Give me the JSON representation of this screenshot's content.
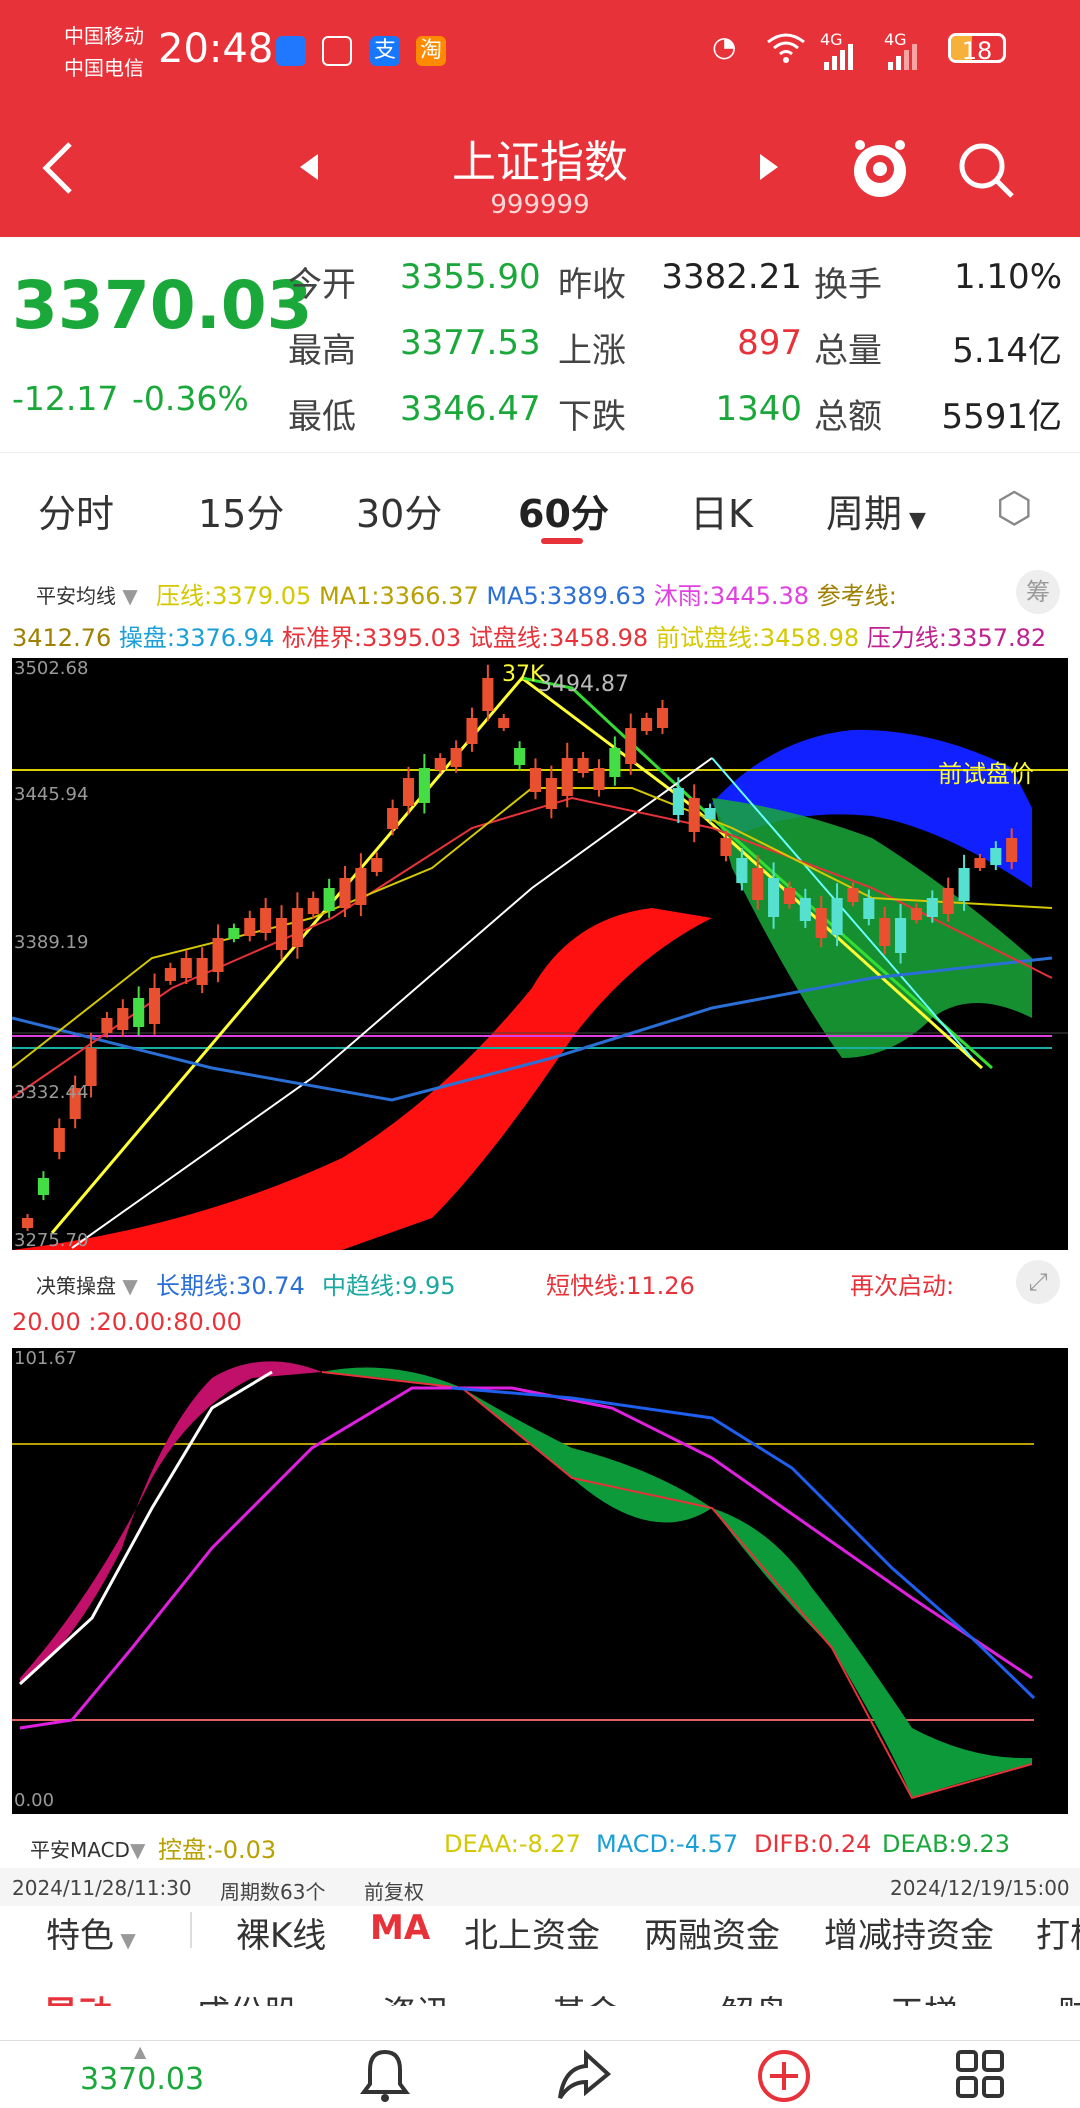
{
  "status": {
    "carrier1": "中国移动",
    "carrier2": "中国电信",
    "time": "20:48",
    "net1": "4G",
    "net2": "4G",
    "battery": "18"
  },
  "header": {
    "title": "上证指数",
    "code": "999999"
  },
  "quote": {
    "price": "3370.03",
    "change": "-12.17",
    "change_pct": "-0.36%",
    "open_label": "今开",
    "open": "3355.90",
    "prev_label": "昨收",
    "prev": "3382.21",
    "turn_label": "换手",
    "turn": "1.10%",
    "high_label": "最高",
    "high": "3377.53",
    "up_label": "上涨",
    "up": "897",
    "vol_label": "总量",
    "vol": "5.14亿",
    "low_label": "最低",
    "low": "3346.47",
    "down_label": "下跌",
    "down": "1340",
    "amt_label": "总额",
    "amt": "5591亿"
  },
  "tabs": [
    "分时",
    "15分",
    "30分",
    "60分",
    "日K",
    "周期"
  ],
  "main_indicator": {
    "name": "平安均线",
    "l1": [
      "压线:3379.05",
      "MA1:3366.37",
      "MA5:3389.63",
      "沐雨:3445.38",
      "参考线:"
    ],
    "l2": [
      "3412.76",
      "操盘:3376.94",
      "标准界:3395.03",
      "试盘线:3458.98",
      "前试盘线:3458.98",
      "压力线:3357.82"
    ],
    "badge": "筹"
  },
  "kline": {
    "y_labels": [
      "3502.68",
      "3445.94",
      "3389.19",
      "3332.44",
      "3275.70"
    ],
    "top_tag": "37K",
    "top_price": "3494.87",
    "right_tag": "前试盘价"
  },
  "sub_indicator": {
    "name": "决策操盘",
    "long": "长期线:30.74",
    "mid": "中趋线:9.95",
    "short": "短快线:11.26",
    "restart": "再次启动:",
    "levels": [
      "20.00",
      ":20.00",
      ":80.00"
    ],
    "y_top": "101.67",
    "y_bottom": "0.00"
  },
  "macd": {
    "name": "平安MACD",
    "ctrl": "控盘:-0.03",
    "deaa": "DEAA:-8.27",
    "macd": "MACD:-4.57",
    "difb": "DIFB:0.24",
    "deab": "DEAB:9.23"
  },
  "footer": {
    "start": "2024/11/28/11:30",
    "count": "周期数63个",
    "adj": "前复权",
    "end": "2024/12/19/15:00"
  },
  "menu": [
    "特色",
    "裸K线",
    "MA",
    "北上资金",
    "两融资金",
    "增减持资金",
    "打板"
  ],
  "submenu": [
    "异动",
    "成份股",
    "资讯",
    "基金",
    "解盘",
    "天梯",
    "财"
  ],
  "nav": {
    "price": "3370.03"
  },
  "colors": {
    "brand": "#e8323a",
    "up": "#e8323a",
    "down": "#1aa83a"
  }
}
